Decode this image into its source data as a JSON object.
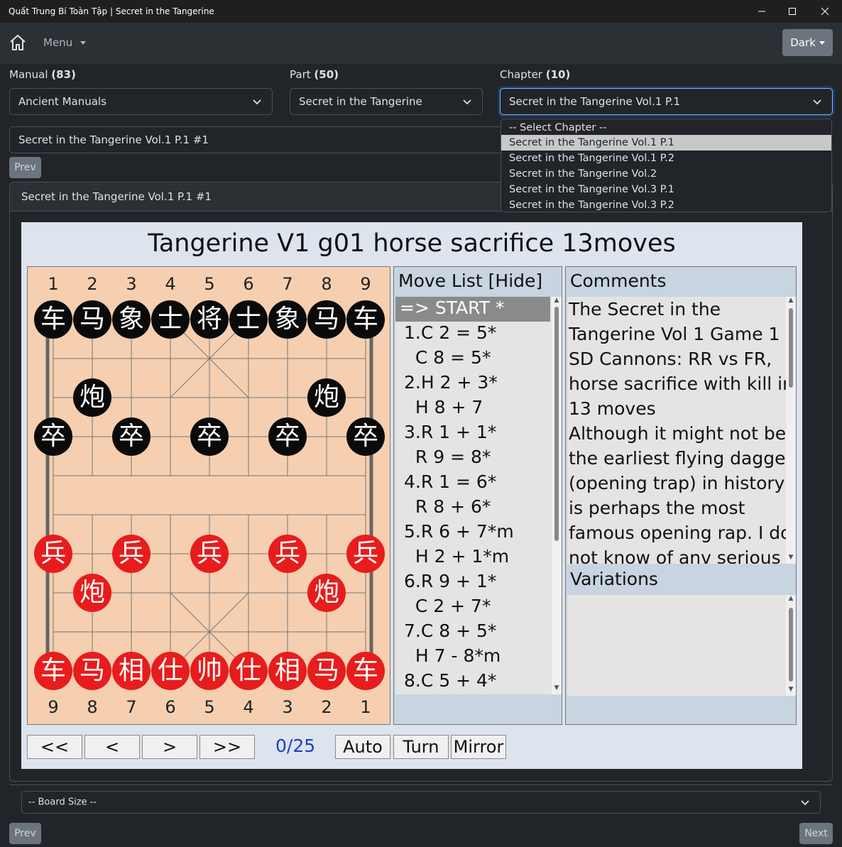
{
  "window": {
    "title": "Quất Trung Bí Toàn Tập | Secret in the Tangerine",
    "min_icon": "minimize-icon",
    "max_icon": "maximize-icon",
    "close_icon": "close-icon"
  },
  "navbar": {
    "home_icon": "home-icon",
    "menu_label": "Menu",
    "theme_label": "Dark"
  },
  "filters": {
    "manual_label": "Manual",
    "manual_count": "(83)",
    "manual_value": "Ancient Manuals",
    "part_label": "Part",
    "part_count": "(50)",
    "part_value": "Secret in the Tangerine",
    "chapter_label": "Chapter",
    "chapter_count": "(10)",
    "chapter_value": "Secret in the Tangerine Vol.1 P.1"
  },
  "chapter_options": [
    "-- Select Chapter --",
    "Secret in the Tangerine Vol.1 P.1",
    "Secret in the Tangerine Vol.1 P.2",
    "Secret in the Tangerine Vol.2",
    "Secret in the Tangerine Vol.3 P.1",
    "Secret in the Tangerine Vol.3 P.2"
  ],
  "game_select_value": "Secret in the Tangerine Vol.1 P.1 #1",
  "prev_label": "Prev",
  "next_label": "Next",
  "card_header": "Secret in the Tangerine Vol.1 P.1 #1",
  "game": {
    "title": "Tangerine V1 g01 horse sacrifice 13moves",
    "top_files": [
      "1",
      "2",
      "3",
      "4",
      "5",
      "6",
      "7",
      "8",
      "9"
    ],
    "bottom_files": [
      "9",
      "8",
      "7",
      "6",
      "5",
      "4",
      "3",
      "2",
      "1"
    ],
    "pieces": [
      {
        "char": "车",
        "color": "black",
        "file": 0,
        "rank": 0
      },
      {
        "char": "马",
        "color": "black",
        "file": 1,
        "rank": 0
      },
      {
        "char": "象",
        "color": "black",
        "file": 2,
        "rank": 0
      },
      {
        "char": "士",
        "color": "black",
        "file": 3,
        "rank": 0
      },
      {
        "char": "将",
        "color": "black",
        "file": 4,
        "rank": 0
      },
      {
        "char": "士",
        "color": "black",
        "file": 5,
        "rank": 0
      },
      {
        "char": "象",
        "color": "black",
        "file": 6,
        "rank": 0
      },
      {
        "char": "马",
        "color": "black",
        "file": 7,
        "rank": 0
      },
      {
        "char": "车",
        "color": "black",
        "file": 8,
        "rank": 0
      },
      {
        "char": "炮",
        "color": "black",
        "file": 1,
        "rank": 2
      },
      {
        "char": "炮",
        "color": "black",
        "file": 7,
        "rank": 2
      },
      {
        "char": "卒",
        "color": "black",
        "file": 0,
        "rank": 3
      },
      {
        "char": "卒",
        "color": "black",
        "file": 2,
        "rank": 3
      },
      {
        "char": "卒",
        "color": "black",
        "file": 4,
        "rank": 3
      },
      {
        "char": "卒",
        "color": "black",
        "file": 6,
        "rank": 3
      },
      {
        "char": "卒",
        "color": "black",
        "file": 8,
        "rank": 3
      },
      {
        "char": "兵",
        "color": "red",
        "file": 0,
        "rank": 6
      },
      {
        "char": "兵",
        "color": "red",
        "file": 2,
        "rank": 6
      },
      {
        "char": "兵",
        "color": "red",
        "file": 4,
        "rank": 6
      },
      {
        "char": "兵",
        "color": "red",
        "file": 6,
        "rank": 6
      },
      {
        "char": "兵",
        "color": "red",
        "file": 8,
        "rank": 6
      },
      {
        "char": "炮",
        "color": "red",
        "file": 1,
        "rank": 7
      },
      {
        "char": "炮",
        "color": "red",
        "file": 7,
        "rank": 7
      },
      {
        "char": "车",
        "color": "red",
        "file": 0,
        "rank": 9
      },
      {
        "char": "马",
        "color": "red",
        "file": 1,
        "rank": 9
      },
      {
        "char": "相",
        "color": "red",
        "file": 2,
        "rank": 9
      },
      {
        "char": "仕",
        "color": "red",
        "file": 3,
        "rank": 9
      },
      {
        "char": "帅",
        "color": "red",
        "file": 4,
        "rank": 9
      },
      {
        "char": "仕",
        "color": "red",
        "file": 5,
        "rank": 9
      },
      {
        "char": "相",
        "color": "red",
        "file": 6,
        "rank": 9
      },
      {
        "char": "马",
        "color": "red",
        "file": 7,
        "rank": 9
      },
      {
        "char": "车",
        "color": "red",
        "file": 8,
        "rank": 9
      }
    ],
    "move_list_title": "Move List [Hide]",
    "moves": [
      "=> START *",
      "1.C 2 = 5*",
      "  C 8 = 5*",
      "2.H 2 + 3*",
      "  H 8 + 7",
      "3.R 1 + 1*",
      "  R 9 = 8*",
      "4.R 1 = 6*",
      "  R 8 + 6*",
      "5.R 6 + 7*m",
      "  H 2 + 1*m",
      "6.R 9 + 1*",
      "  C 2 + 7*",
      "7.C 8 + 5*",
      "  H 7 - 8*m",
      "8.C 5 + 4*"
    ],
    "comments_title": "Comments",
    "comments_lines": [
      "The Secret in the",
      "Tangerine Vol 1 Game 1",
      "SD Cannons: RR vs FR,",
      "horse sacrifice with kill in",
      "13 moves",
      "Although it might not be",
      "the earliest flying dagger",
      "(opening trap) in history, it",
      "is perhaps the most",
      "famous opening rap. I do",
      "not know of anv serious"
    ],
    "variations_title": "Variations",
    "controls": {
      "first": "<<",
      "prev": "<",
      "next": ">",
      "last": ">>",
      "progress": "0/25",
      "auto": "Auto",
      "turn": "Turn",
      "mirror": "Mirror"
    }
  },
  "board_size_value": "-- Board Size --",
  "colors": {
    "board": "#f5cfb0",
    "red_piece": "#e81c1c",
    "black_piece": "#0a0a0a",
    "progress": "#1a3fc7"
  }
}
